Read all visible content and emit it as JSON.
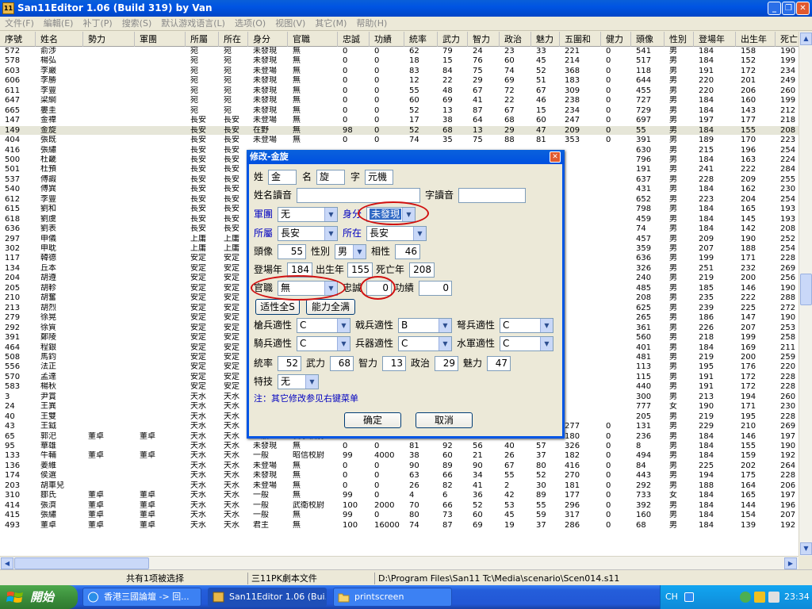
{
  "window": {
    "title": "San11Editor 1.06 (Build 319) by Van",
    "app_icon_text": "11"
  },
  "menu": [
    "文件(F)",
    "編輯(E)",
    "补丁(P)",
    "搜索(S)",
    "默认游戏语言(L)",
    "选项(O)",
    "视图(V)",
    "其它(M)",
    "帮助(H)"
  ],
  "columns": [
    "序號",
    "姓名",
    "勢力",
    "軍團",
    "所屬",
    "所在",
    "身分",
    "官職",
    "忠誠",
    "功績",
    "統率",
    "武力",
    "智力",
    "政治",
    "魅力",
    "五圍和",
    "健力",
    "頭像",
    "性別",
    "登場年",
    "出生年",
    "死亡"
  ],
  "rows": [
    [
      "572",
      "俞涉",
      "",
      "",
      "宛",
      "宛",
      "未發現",
      "無",
      "0",
      "0",
      "62",
      "79",
      "24",
      "23",
      "33",
      "221",
      "0",
      "541",
      "男",
      "184",
      "158",
      "190"
    ],
    [
      "578",
      "楊弘",
      "",
      "",
      "宛",
      "宛",
      "未發現",
      "無",
      "0",
      "0",
      "18",
      "15",
      "76",
      "60",
      "45",
      "214",
      "0",
      "517",
      "男",
      "184",
      "152",
      "199"
    ],
    [
      "603",
      "李嚴",
      "",
      "",
      "宛",
      "宛",
      "未登場",
      "無",
      "0",
      "0",
      "83",
      "84",
      "75",
      "74",
      "52",
      "368",
      "0",
      "118",
      "男",
      "191",
      "172",
      "234"
    ],
    [
      "606",
      "李勝",
      "",
      "",
      "宛",
      "宛",
      "未發現",
      "無",
      "0",
      "0",
      "12",
      "22",
      "29",
      "69",
      "51",
      "183",
      "0",
      "644",
      "男",
      "220",
      "201",
      "249"
    ],
    [
      "611",
      "李豐",
      "",
      "",
      "宛",
      "宛",
      "未發現",
      "無",
      "0",
      "0",
      "55",
      "48",
      "67",
      "72",
      "67",
      "309",
      "0",
      "455",
      "男",
      "220",
      "206",
      "260"
    ],
    [
      "647",
      "梁綱",
      "",
      "",
      "宛",
      "宛",
      "未發現",
      "無",
      "0",
      "0",
      "60",
      "69",
      "41",
      "22",
      "46",
      "238",
      "0",
      "727",
      "男",
      "184",
      "160",
      "199"
    ],
    [
      "665",
      "婁圭",
      "",
      "",
      "宛",
      "宛",
      "未發現",
      "無",
      "0",
      "0",
      "52",
      "13",
      "87",
      "67",
      "15",
      "234",
      "0",
      "729",
      "男",
      "184",
      "143",
      "212"
    ],
    [
      "147",
      "金禕",
      "",
      "",
      "長安",
      "長安",
      "未登場",
      "無",
      "0",
      "0",
      "17",
      "38",
      "64",
      "68",
      "60",
      "247",
      "0",
      "697",
      "男",
      "197",
      "177",
      "218"
    ],
    [
      "149",
      "金旋",
      "",
      "",
      "長安",
      "長安",
      "在野",
      "無",
      "98",
      "0",
      "52",
      "68",
      "13",
      "29",
      "47",
      "209",
      "0",
      "55",
      "男",
      "184",
      "155",
      "208"
    ],
    [
      "404",
      "張既",
      "",
      "",
      "長安",
      "長安",
      "未登場",
      "無",
      "0",
      "0",
      "74",
      "35",
      "75",
      "88",
      "81",
      "353",
      "0",
      "391",
      "男",
      "189",
      "170",
      "223"
    ],
    [
      "416",
      "張繡",
      "",
      "",
      "長安",
      "長安",
      "",
      "",
      "",
      "",
      "",
      "",
      "",
      "",
      "",
      "",
      "",
      "630",
      "男",
      "215",
      "196",
      "254"
    ],
    [
      "500",
      "杜畿",
      "",
      "",
      "長安",
      "長安",
      "",
      "",
      "",
      "",
      "",
      "",
      "",
      "",
      "",
      "",
      "",
      "796",
      "男",
      "184",
      "163",
      "224"
    ],
    [
      "501",
      "杜預",
      "",
      "",
      "長安",
      "長安",
      "",
      "",
      "",
      "",
      "",
      "",
      "",
      "",
      "",
      "",
      "",
      "191",
      "男",
      "241",
      "222",
      "284"
    ],
    [
      "537",
      "傅嘏",
      "",
      "",
      "長安",
      "長安",
      "",
      "",
      "",
      "",
      "",
      "",
      "",
      "",
      "",
      "",
      "",
      "637",
      "男",
      "228",
      "209",
      "255"
    ],
    [
      "540",
      "傅巽",
      "",
      "",
      "長安",
      "長安",
      "",
      "",
      "",
      "",
      "",
      "",
      "",
      "",
      "",
      "",
      "",
      "431",
      "男",
      "184",
      "162",
      "230"
    ],
    [
      "612",
      "李豐",
      "",
      "",
      "長安",
      "長安",
      "",
      "",
      "",
      "",
      "",
      "",
      "",
      "",
      "",
      "",
      "",
      "652",
      "男",
      "223",
      "204",
      "254"
    ],
    [
      "615",
      "劉和",
      "",
      "",
      "長安",
      "長安",
      "",
      "",
      "",
      "",
      "",
      "",
      "",
      "",
      "",
      "",
      "",
      "798",
      "男",
      "184",
      "165",
      "193"
    ],
    [
      "618",
      "劉虞",
      "",
      "",
      "長安",
      "長安",
      "",
      "",
      "",
      "",
      "",
      "",
      "",
      "",
      "",
      "",
      "",
      "459",
      "男",
      "184",
      "145",
      "193"
    ],
    [
      "636",
      "劉表",
      "",
      "",
      "長安",
      "長安",
      "",
      "",
      "",
      "",
      "",
      "",
      "",
      "",
      "",
      "",
      "",
      "74",
      "男",
      "184",
      "142",
      "208"
    ],
    [
      "297",
      "申儀",
      "",
      "",
      "上庸",
      "上庸",
      "",
      "",
      "",
      "",
      "",
      "",
      "",
      "",
      "",
      "",
      "",
      "457",
      "男",
      "209",
      "190",
      "252"
    ],
    [
      "302",
      "申耽",
      "",
      "",
      "上庸",
      "上庸",
      "",
      "",
      "",
      "",
      "",
      "",
      "",
      "",
      "",
      "",
      "",
      "359",
      "男",
      "207",
      "188",
      "254"
    ],
    [
      "117",
      "韓德",
      "",
      "",
      "安定",
      "安定",
      "",
      "",
      "",
      "",
      "",
      "",
      "",
      "",
      "",
      "",
      "",
      "636",
      "男",
      "199",
      "171",
      "228"
    ],
    [
      "134",
      "丘本",
      "",
      "",
      "安定",
      "安定",
      "",
      "",
      "",
      "",
      "",
      "",
      "",
      "",
      "",
      "",
      "",
      "326",
      "男",
      "251",
      "232",
      "269"
    ],
    [
      "204",
      "胡遵",
      "",
      "",
      "安定",
      "安定",
      "",
      "",
      "",
      "",
      "",
      "",
      "",
      "",
      "",
      "",
      "",
      "240",
      "男",
      "219",
      "200",
      "256"
    ],
    [
      "205",
      "胡軫",
      "",
      "",
      "安定",
      "安定",
      "",
      "",
      "",
      "",
      "",
      "",
      "",
      "",
      "",
      "",
      "",
      "485",
      "男",
      "185",
      "146",
      "190"
    ],
    [
      "210",
      "胡奮",
      "",
      "",
      "安定",
      "安定",
      "",
      "",
      "",
      "",
      "",
      "",
      "",
      "",
      "",
      "",
      "",
      "208",
      "男",
      "235",
      "222",
      "288"
    ],
    [
      "213",
      "胡烈",
      "",
      "",
      "安定",
      "安定",
      "",
      "",
      "",
      "",
      "",
      "",
      "",
      "",
      "",
      "",
      "",
      "625",
      "男",
      "239",
      "225",
      "272"
    ],
    [
      "279",
      "徐晃",
      "",
      "",
      "安定",
      "安定",
      "",
      "",
      "",
      "",
      "",
      "",
      "",
      "",
      "",
      "",
      "",
      "265",
      "男",
      "186",
      "147",
      "190"
    ],
    [
      "292",
      "徐質",
      "",
      "",
      "安定",
      "安定",
      "",
      "",
      "",
      "",
      "",
      "",
      "",
      "",
      "",
      "",
      "",
      "361",
      "男",
      "226",
      "207",
      "253"
    ],
    [
      "391",
      "鄭陵",
      "",
      "",
      "安定",
      "安定",
      "",
      "",
      "",
      "",
      "",
      "",
      "",
      "",
      "",
      "",
      "",
      "560",
      "男",
      "218",
      "199",
      "258"
    ],
    [
      "464",
      "程銀",
      "",
      "",
      "安定",
      "安定",
      "",
      "",
      "",
      "",
      "",
      "",
      "",
      "",
      "",
      "",
      "",
      "401",
      "男",
      "184",
      "169",
      "211"
    ],
    [
      "508",
      "馬鈞",
      "",
      "",
      "安定",
      "安定",
      "",
      "",
      "",
      "",
      "",
      "",
      "",
      "",
      "",
      "",
      "",
      "481",
      "男",
      "219",
      "200",
      "259"
    ],
    [
      "556",
      "法正",
      "",
      "",
      "安定",
      "安定",
      "",
      "",
      "",
      "",
      "",
      "",
      "",
      "",
      "",
      "",
      "",
      "113",
      "男",
      "195",
      "176",
      "220"
    ],
    [
      "570",
      "孟達",
      "",
      "",
      "安定",
      "安定",
      "",
      "",
      "",
      "",
      "",
      "",
      "",
      "",
      "",
      "",
      "",
      "115",
      "男",
      "191",
      "172",
      "228"
    ],
    [
      "583",
      "楊秋",
      "",
      "",
      "安定",
      "安定",
      "",
      "",
      "",
      "",
      "",
      "",
      "",
      "",
      "",
      "",
      "",
      "440",
      "男",
      "191",
      "172",
      "228"
    ],
    [
      "3",
      "尹賞",
      "",
      "",
      "天水",
      "天水",
      "",
      "",
      "",
      "",
      "",
      "",
      "",
      "",
      "",
      "",
      "",
      "300",
      "男",
      "213",
      "194",
      "260"
    ],
    [
      "24",
      "王異",
      "",
      "",
      "天水",
      "天水",
      "",
      "",
      "",
      "",
      "",
      "",
      "",
      "",
      "",
      "",
      "",
      "777",
      "女",
      "190",
      "171",
      "230"
    ],
    [
      "40",
      "王雙",
      "",
      "",
      "天水",
      "天水",
      "",
      "",
      "",
      "",
      "",
      "",
      "",
      "",
      "",
      "",
      "",
      "205",
      "男",
      "219",
      "195",
      "228"
    ],
    [
      "43",
      "王鉞",
      "",
      "",
      "天水",
      "天水",
      "未登場",
      "無",
      "0",
      "0",
      "46",
      "59",
      "72",
      "51",
      "49",
      "277",
      "0",
      "131",
      "男",
      "229",
      "210",
      "269"
    ],
    [
      "65",
      "郭汜",
      "董卓",
      "董卓",
      "天水",
      "天水",
      "一般",
      "長水校尉",
      "100",
      "2000",
      "64",
      "76",
      "13",
      "14",
      "13",
      "180",
      "0",
      "236",
      "男",
      "184",
      "146",
      "197"
    ],
    [
      "95",
      "華雄",
      "",
      "",
      "天水",
      "天水",
      "未發現",
      "無",
      "0",
      "0",
      "81",
      "92",
      "56",
      "40",
      "57",
      "326",
      "0",
      "8",
      "男",
      "184",
      "155",
      "190"
    ],
    [
      "133",
      "牛輔",
      "董卓",
      "董卓",
      "天水",
      "天水",
      "一般",
      "昭信校尉",
      "99",
      "4000",
      "38",
      "60",
      "21",
      "26",
      "37",
      "182",
      "0",
      "494",
      "男",
      "184",
      "159",
      "192"
    ],
    [
      "136",
      "姜維",
      "",
      "",
      "天水",
      "天水",
      "未登場",
      "無",
      "0",
      "0",
      "90",
      "89",
      "90",
      "67",
      "80",
      "416",
      "0",
      "84",
      "男",
      "225",
      "202",
      "264"
    ],
    [
      "174",
      "侯選",
      "",
      "",
      "天水",
      "天水",
      "未發現",
      "無",
      "0",
      "0",
      "63",
      "66",
      "34",
      "55",
      "52",
      "270",
      "0",
      "443",
      "男",
      "194",
      "175",
      "228"
    ],
    [
      "203",
      "胡車兒",
      "",
      "",
      "天水",
      "天水",
      "未登場",
      "無",
      "0",
      "0",
      "26",
      "82",
      "41",
      "2",
      "30",
      "181",
      "0",
      "292",
      "男",
      "188",
      "164",
      "206"
    ],
    [
      "310",
      "鄒氏",
      "董卓",
      "董卓",
      "天水",
      "天水",
      "一般",
      "無",
      "99",
      "0",
      "4",
      "6",
      "36",
      "42",
      "89",
      "177",
      "0",
      "733",
      "女",
      "184",
      "165",
      "197"
    ],
    [
      "414",
      "張濟",
      "董卓",
      "董卓",
      "天水",
      "天水",
      "一般",
      "武衛校尉",
      "100",
      "2000",
      "70",
      "66",
      "52",
      "53",
      "55",
      "296",
      "0",
      "392",
      "男",
      "184",
      "144",
      "196"
    ],
    [
      "415",
      "張繡",
      "董卓",
      "董卓",
      "天水",
      "天水",
      "一般",
      "無",
      "99",
      "0",
      "80",
      "73",
      "60",
      "45",
      "59",
      "317",
      "0",
      "160",
      "男",
      "184",
      "154",
      "207"
    ],
    [
      "493",
      "董卓",
      "董卓",
      "董卓",
      "天水",
      "天水",
      "君主",
      "無",
      "100",
      "16000",
      "74",
      "87",
      "69",
      "19",
      "37",
      "286",
      "0",
      "68",
      "男",
      "184",
      "139",
      "192"
    ]
  ],
  "selected_row": 8,
  "status": {
    "selection": "共有1项被选择",
    "file_type": "三11PK劇本文件",
    "path": "D:\\Program Files\\San11 Tc\\Media\\scenario\\Scen014.s11"
  },
  "dialog": {
    "title": "修改-金旋",
    "surname_label": "姓",
    "surname": "金",
    "given_label": "名",
    "given": "旋",
    "style_label": "字",
    "style": "元機",
    "reading_label": "姓名讀音",
    "reading": "",
    "style_reading_label": "字讀音",
    "style_reading": "",
    "corps_label": "軍團",
    "corps": "无",
    "status_label": "身分",
    "status": "未發現",
    "belong_label": "所屬",
    "belong": "長安",
    "location_label": "所在",
    "location": "長安",
    "portrait_label": "頭像",
    "portrait": "55",
    "gender_label": "性別",
    "gender": "男",
    "affinity_label": "相性",
    "affinity": "46",
    "appear_label": "登場年",
    "appear": "184",
    "birth_label": "出生年",
    "birth": "155",
    "death_label": "死亡年",
    "death": "208",
    "rank_label": "官職",
    "rank": "無",
    "loyalty_label": "忠誠",
    "loyalty": "0",
    "merit_label": "功績",
    "merit": "0",
    "btn_aptitude_s": "适性全S",
    "btn_ability_max": "能力全满",
    "spear_label": "槍兵適性",
    "spear": "C",
    "pike_label": "戟兵適性",
    "pike": "B",
    "bow_label": "弩兵適性",
    "bow": "C",
    "cavalry_label": "騎兵適性",
    "cavalry": "C",
    "siege_label": "兵器適性",
    "siege": "C",
    "navy_label": "水軍適性",
    "navy": "C",
    "lead_label": "統率",
    "lead": "52",
    "war_label": "武力",
    "war": "68",
    "intel_label": "智力",
    "intel": "13",
    "pol_label": "政治",
    "pol": "29",
    "chr_label": "魅力",
    "chr": "47",
    "skill_label": "特技",
    "skill": "无",
    "note": "注：其它修改参见右键菜单",
    "ok": "确定",
    "cancel": "取消"
  },
  "taskbar": {
    "start": "開始",
    "tasks": [
      "香港三國論壇 -> 回...",
      "San11Editor 1.06 (Bui...",
      "printscreen"
    ],
    "lang": "CH",
    "clock": "23:34"
  },
  "colors": {
    "accent": "#0054e3",
    "highlight": "#316ac5",
    "annotation": "#d01010"
  }
}
